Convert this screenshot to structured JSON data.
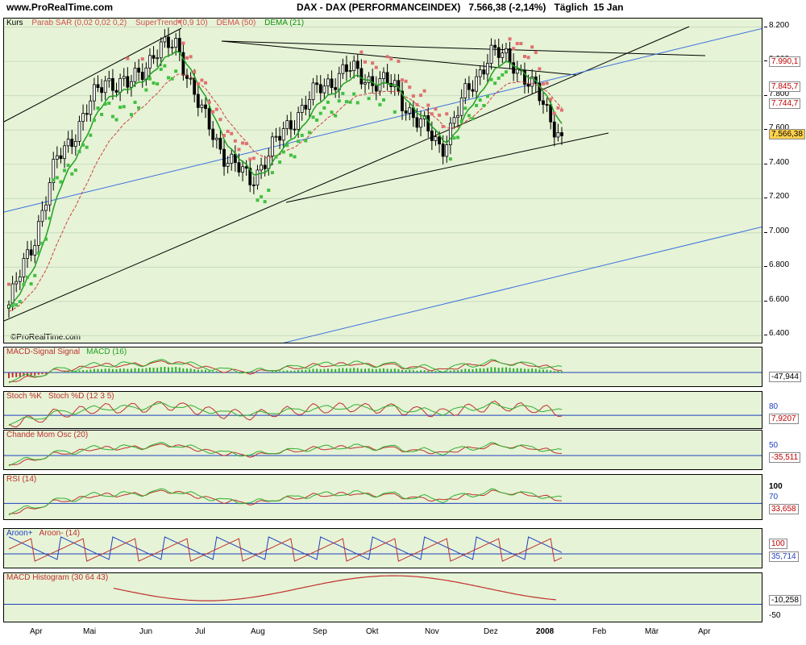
{
  "header": {
    "site": "www.ProRealTime.com",
    "title": "DAX - DAX (PERFORMANCEINDEX)",
    "quote": "7.566,38 (-2,14%)",
    "period": "Täglich",
    "date": "15 Jan"
  },
  "watermark": "©ProRealTime.com",
  "colors": {
    "pane_bg": "#e6f3d6",
    "sar": "#e07070",
    "supertrend": "#40c040",
    "dema50": "#d04040",
    "dema21": "#20a020",
    "trendline": "#000000",
    "channel_blue": "#3a70e0"
  },
  "chart_data": [
    {
      "type": "candlestick",
      "legend": {
        "kurs": "Kurs",
        "sar": "Parab SAR (0,02 0,02 0,2)",
        "supertrend": "SuperTrend (0,9 10)",
        "dema50": "DEMA (50)",
        "dema21": "DEMA (21)"
      },
      "ylim": [
        6350,
        8250
      ],
      "yticks": [
        "8.200",
        "8.000",
        "7.800",
        "7.600",
        "7.400",
        "7.200",
        "7.000",
        "6.800",
        "6.600",
        "6.400"
      ],
      "value_labels": [
        "7.990,1",
        "7.845,7",
        "7.744,7",
        "7.566,38"
      ],
      "x": [
        "Mar 20",
        "Apr 5",
        "Apr 25",
        "May 10",
        "Jun 1",
        "Jun 15",
        "Jul 5",
        "Jul 19",
        "Aug 2",
        "Aug 10",
        "Aug 16",
        "Sep 1",
        "Sep 15",
        "Oct 1",
        "Oct 12",
        "Oct 25",
        "Nov 7",
        "Nov 20",
        "Nov 28",
        "Dec 10",
        "Dec 19",
        "Dec 28",
        "Jan 7",
        "Jan 15"
      ],
      "close": [
        6580,
        6950,
        7420,
        7650,
        7900,
        7850,
        8050,
        8100,
        7700,
        7450,
        7300,
        7500,
        7700,
        7850,
        7950,
        7900,
        7850,
        7650,
        7500,
        7800,
        8050,
        8000,
        7800,
        7566
      ]
    },
    {
      "type": "line",
      "legend": [
        "MACD-Signal Signal",
        "MACD (16)"
      ],
      "value_label": "-47,944"
    },
    {
      "type": "line",
      "legend": [
        "Stoch %K",
        "Stoch %D (12 3 5)"
      ],
      "ytick": "80",
      "value_label": "7,9207"
    },
    {
      "type": "line",
      "legend": [
        "Chande Mom Osc (20)"
      ],
      "ytick": "50",
      "value_label": "-35,511"
    },
    {
      "type": "line",
      "legend": [
        "RSI (14)"
      ],
      "yticks": [
        "100",
        "70"
      ],
      "value_label": "33,658"
    },
    {
      "type": "line",
      "legend": [
        "Aroon+",
        "Aroon- (14)"
      ],
      "value_labels": [
        "100",
        "35,714"
      ]
    },
    {
      "type": "line",
      "legend": [
        "MACD Histogram (30 64 43)"
      ],
      "ytick": "-50",
      "value_label": "-10,258"
    }
  ],
  "xaxis": [
    "Apr",
    "Mai",
    "Jun",
    "Jul",
    "Aug",
    "Sep",
    "Okt",
    "Nov",
    "Dez",
    "2008",
    "Feb",
    "Mär",
    "Apr"
  ]
}
